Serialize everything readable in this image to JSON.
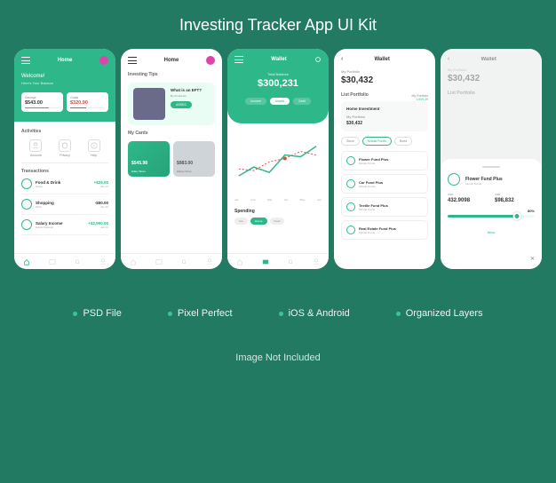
{
  "title": "Investing Tracker App UI Kit",
  "features": [
    "PSD File",
    "Pixel Perfect",
    "iOS & Android",
    "Organized Layers"
  ],
  "footer": "Image Not Included",
  "colors": {
    "primary": "#2eb88a",
    "bg": "#237a63",
    "red": "#e04848"
  },
  "screen1": {
    "title": "Home",
    "welcome": "Welcome!",
    "welcome_sub": "Here's Your Balance",
    "savings": {
      "label": "Savings",
      "value": "$543.00"
    },
    "goals": {
      "label": "Goals",
      "value": "$320.90"
    },
    "activities_title": "Activities",
    "activities": [
      {
        "label": "Account"
      },
      {
        "label": "Privacy"
      },
      {
        "label": "Help"
      }
    ],
    "transactions_title": "Transactions",
    "transactions": [
      {
        "name": "Food & Drink",
        "sub": "Today",
        "amount": "+$25.00",
        "date": "Jan 12"
      },
      {
        "name": "Shopping",
        "sub": "2023",
        "amount": "-$50.00",
        "date": "Jan 10"
      },
      {
        "name": "Salary Income",
        "sub": "Euras Palawan",
        "amount": "+$2,900.00",
        "date": "Jan 02"
      }
    ]
  },
  "screen2": {
    "title": "Home",
    "tips_title": "Investing Tips",
    "tip": {
      "question": "What is an EFT?",
      "by": "By Arnold tes",
      "button": "ASSES"
    },
    "mycards_title": "My Cards",
    "cards": [
      {
        "value": "$545.98",
        "name": "Hilary Sizes"
      },
      {
        "value": "$983.00",
        "name": "Margo Sizes"
      }
    ]
  },
  "screen3": {
    "title": "Wallet",
    "balance_label": "Total Balance",
    "balance": "$300,231",
    "tabs": [
      "Income",
      "Assets",
      "Debt"
    ],
    "active_tab": 1,
    "months": [
      "Jan",
      "Feb",
      "Mar",
      "Apr",
      "May",
      "Jun"
    ],
    "spending_title": "Spending",
    "spending_tabs": [
      "Car",
      "House",
      "Food"
    ],
    "chart_data": {
      "type": "line",
      "x": [
        "Jan",
        "Feb",
        "Mar",
        "Apr",
        "May",
        "Jun"
      ],
      "series": [
        {
          "name": "green",
          "values": [
            20,
            35,
            25,
            50,
            48,
            62
          ]
        },
        {
          "name": "red",
          "values": [
            30,
            28,
            40,
            45,
            55,
            50
          ]
        }
      ]
    }
  },
  "screen4": {
    "title": "Wallet",
    "portfolio_label": "My Portfolio",
    "portfolio_value": "$30,432",
    "right1": "My Portfolio",
    "right2": "1,609.29",
    "list_title": "List Portfolio",
    "home_inv": {
      "title": "Home Investment",
      "label": "My Portfolio",
      "value": "$30,432"
    },
    "filters": [
      "Stock",
      "Mutual Funds",
      "Bond"
    ],
    "active_filter": 1,
    "funds": [
      {
        "name": "Flower Fund Plus",
        "sub": "Mutual Funds"
      },
      {
        "name": "Car Fund Plus",
        "sub": "Mutual Funds"
      },
      {
        "name": "Textile Fund Plus",
        "sub": "Mutual Funds"
      },
      {
        "name": "Real Estate Fund Plus",
        "sub": "Mutual Funds"
      }
    ]
  },
  "screen5": {
    "title": "Wallet",
    "portfolio_label": "My Portfolio",
    "portfolio_value": "$30,432",
    "list_title": "List Portfolio",
    "fund": {
      "name": "Flower Fund Plus",
      "sub": "Mutual Funds"
    },
    "col1": {
      "label": "USD",
      "value": "432.9098"
    },
    "col2": {
      "label": "USD",
      "value": "$98,832"
    },
    "percent": "80%",
    "alloc": "Alloc"
  }
}
